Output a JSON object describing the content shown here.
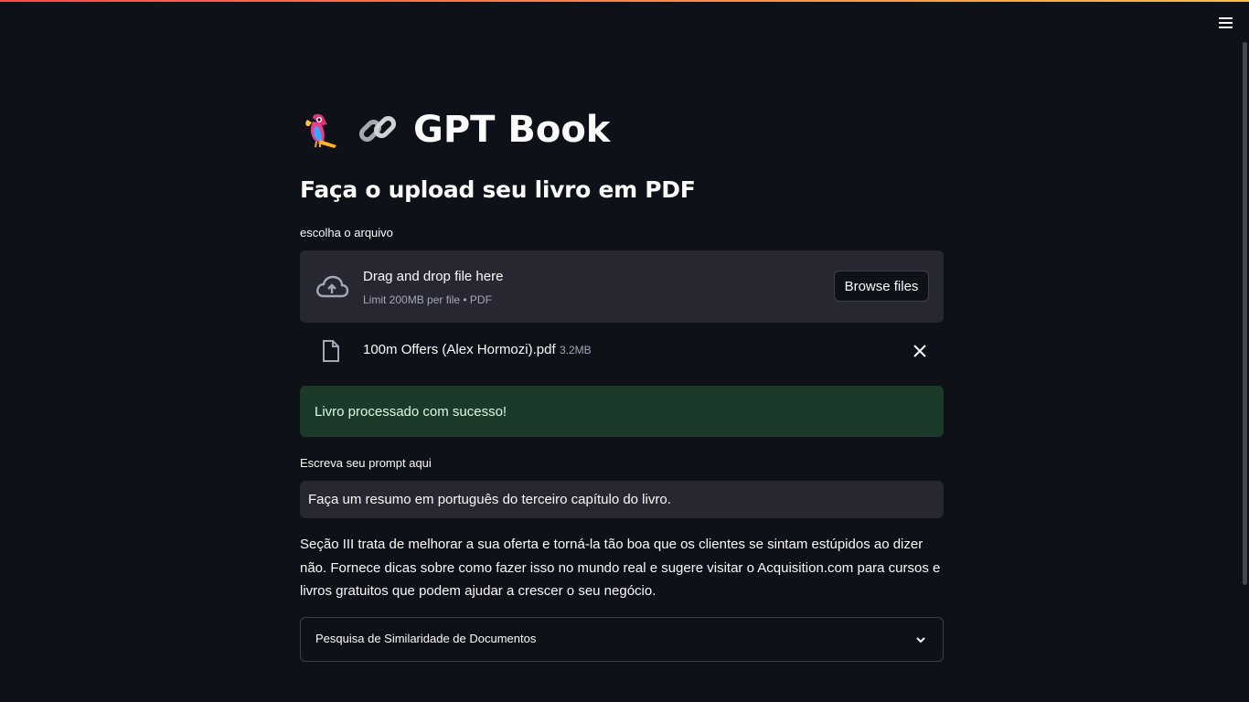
{
  "app": {
    "title": "GPT Book",
    "title_emojis": [
      "parrot-icon",
      "link-icon"
    ]
  },
  "header": {
    "subtitle": "Faça o upload seu livro em PDF"
  },
  "uploader": {
    "label": "escolha o arquivo",
    "drag_text": "Drag and drop file here",
    "limit_text": "Limit 200MB per file • PDF",
    "browse_label": "Browse files",
    "icon": "cloud-upload-icon"
  },
  "uploaded_file": {
    "name": "100m Offers (Alex Hormozi).pdf",
    "size": "3.2MB",
    "icon": "file-icon",
    "remove_icon": "close-icon"
  },
  "status": {
    "message": "Livro processado com sucesso!"
  },
  "prompt": {
    "label": "Escreva seu prompt aqui",
    "value": "Faça um resumo em português do terceiro capítulo do livro."
  },
  "answer": {
    "lines": [
      "Seção III trata de melhorar a sua oferta e torná-la tão boa que os clientes se sintam estúpidos ao dizer",
      "não. Fornece dicas sobre como fazer isso no mundo real e sugere visitar o Acquisition.com para cursos e",
      "livros gratuitos que podem ajudar a crescer o seu negócio."
    ]
  },
  "expander": {
    "label": "Pesquisa de Similaridade de Documentos",
    "icon": "chevron-down-icon"
  },
  "colors": {
    "background": "#0e1117",
    "widget_bg": "#262730",
    "success_bg": "#1b3a2a",
    "text": "#fafafa",
    "muted": "#a3a8b8",
    "accent": "#ff4b4b"
  }
}
